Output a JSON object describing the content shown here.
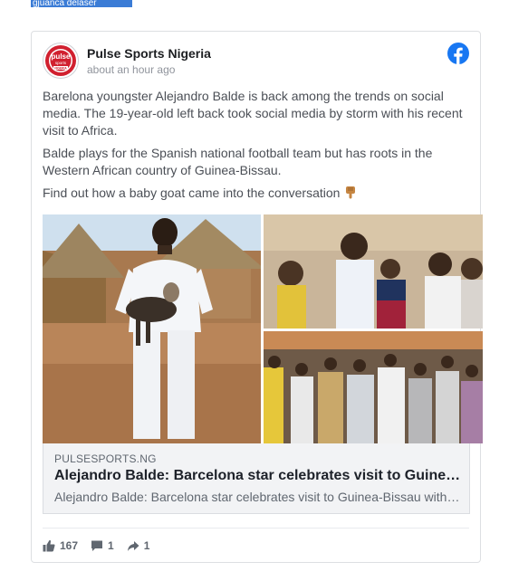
{
  "top_selection": {
    "text": "gjuanca delaser"
  },
  "post": {
    "page_name": "Pulse Sports Nigeria",
    "timestamp": "about an hour ago",
    "avatar_logo": {
      "line1": "pulse",
      "line2": "sports",
      "line3": "NIGERIA"
    },
    "paragraphs": [
      "Barelona youngster Alejandro Balde is back among the trends on social media. The 19-year-old left back took social media by storm with his recent visit to Africa.",
      "Balde plays for the Spanish national football team but has roots in the Western African country of Guinea-Bissau.",
      "Find out how a baby goat came into the conversation"
    ],
    "emoji": "backhand-index-pointing-down"
  },
  "link_preview": {
    "domain": "PULSESPORTS.NG",
    "title": "Alejandro Balde: Barcelona star celebrates visit to Guinea-Bissau",
    "description": "Alejandro Balde: Barcelona star celebrates visit to Guinea-Bissau with baby goat"
  },
  "stats": {
    "likes": "167",
    "comments": "1",
    "shares": "1"
  },
  "colors": {
    "facebook_blue": "#1877f2",
    "pulse_red": "#d1202f",
    "selection_blue": "#3b7cd6"
  }
}
